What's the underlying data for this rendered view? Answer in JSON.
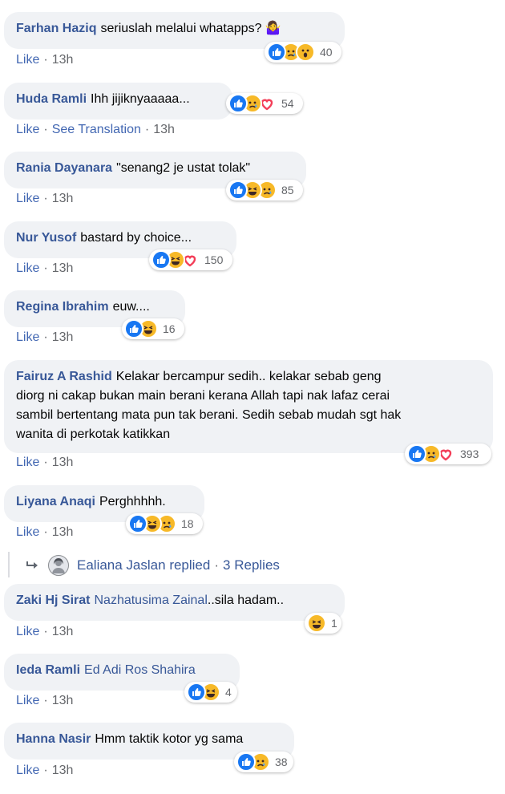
{
  "comments": [
    {
      "name": "Farhan Haziq",
      "text": "seriuslah melalui whatapps? 🤷‍♀️",
      "meta": {
        "like": "Like",
        "time": "13h"
      },
      "reactions": {
        "icons": [
          "like",
          "sad",
          "wow"
        ],
        "count": "40"
      }
    },
    {
      "name": "Huda Ramli",
      "text": "Ihh jijiknyaaaaa...",
      "meta": {
        "like": "Like",
        "see_translation": "See Translation",
        "time": "13h"
      },
      "reactions": {
        "icons": [
          "like",
          "sad",
          "love"
        ],
        "count": "54"
      }
    },
    {
      "name": "Rania Dayanara",
      "text": "\"senang2 je ustat tolak\"",
      "meta": {
        "like": "Like",
        "time": "13h"
      },
      "reactions": {
        "icons": [
          "like",
          "haha",
          "sad"
        ],
        "count": "85"
      }
    },
    {
      "name": "Nur Yusof",
      "text": "bastard by choice...",
      "meta": {
        "like": "Like",
        "time": "13h"
      },
      "reactions": {
        "icons": [
          "like",
          "haha",
          "love"
        ],
        "count": "150"
      }
    },
    {
      "name": "Regina Ibrahim",
      "text": "euw....",
      "meta": {
        "like": "Like",
        "time": "13h"
      },
      "reactions": {
        "icons": [
          "like",
          "haha"
        ],
        "count": "16"
      }
    },
    {
      "name": "Fairuz A Rashid",
      "text_lines": [
        "Kelakar bercampur sedih.. kelakar sebab geng",
        "diorg ni cakap bukan main berani kerana Allah tapi nak lafaz cerai",
        "sambil bertentang mata pun tak berani. Sedih sebab mudah sgt hak",
        "wanita di perkotak katikkan"
      ],
      "meta": {
        "like": "Like",
        "time": "13h"
      },
      "reactions": {
        "icons": [
          "like",
          "sad",
          "love"
        ],
        "count": "393"
      }
    },
    {
      "name": "Liyana Anaqi",
      "text": "Perghhhhh.",
      "meta": {
        "like": "Like",
        "time": "13h"
      },
      "reactions": {
        "icons": [
          "like",
          "haha",
          "sad"
        ],
        "count": "18"
      }
    },
    {
      "name": "Zaki Hj Sirat",
      "mention": "Nazhatusima Zainal",
      "text": "..sila hadam..",
      "meta": {
        "like": "Like",
        "time": "13h"
      },
      "reactions": {
        "icons": [
          "haha"
        ],
        "count": "1"
      }
    },
    {
      "name": "Ieda Ramli",
      "mention": "Ed Adi Ros Shahira",
      "text": "",
      "meta": {
        "like": "Like",
        "time": "13h"
      },
      "reactions": {
        "icons": [
          "like",
          "haha"
        ],
        "count": "4"
      }
    },
    {
      "name": "Hanna Nasir",
      "text": "Hmm taktik kotor yg sama",
      "meta": {
        "like": "Like",
        "time": "13h"
      },
      "reactions": {
        "icons": [
          "like",
          "sad"
        ],
        "count": "38"
      }
    }
  ],
  "replies": {
    "user": "Ealiana Jaslan",
    "action": "replied",
    "separator": "·",
    "count_label": "3 Replies"
  },
  "colors": {
    "name": "#385898",
    "bubble": "#f0f2f5",
    "like_blue": "#1877f2",
    "emoji_yellow": "#f7b928",
    "love_red": "#f33e58",
    "meta_gray": "#65676b"
  }
}
